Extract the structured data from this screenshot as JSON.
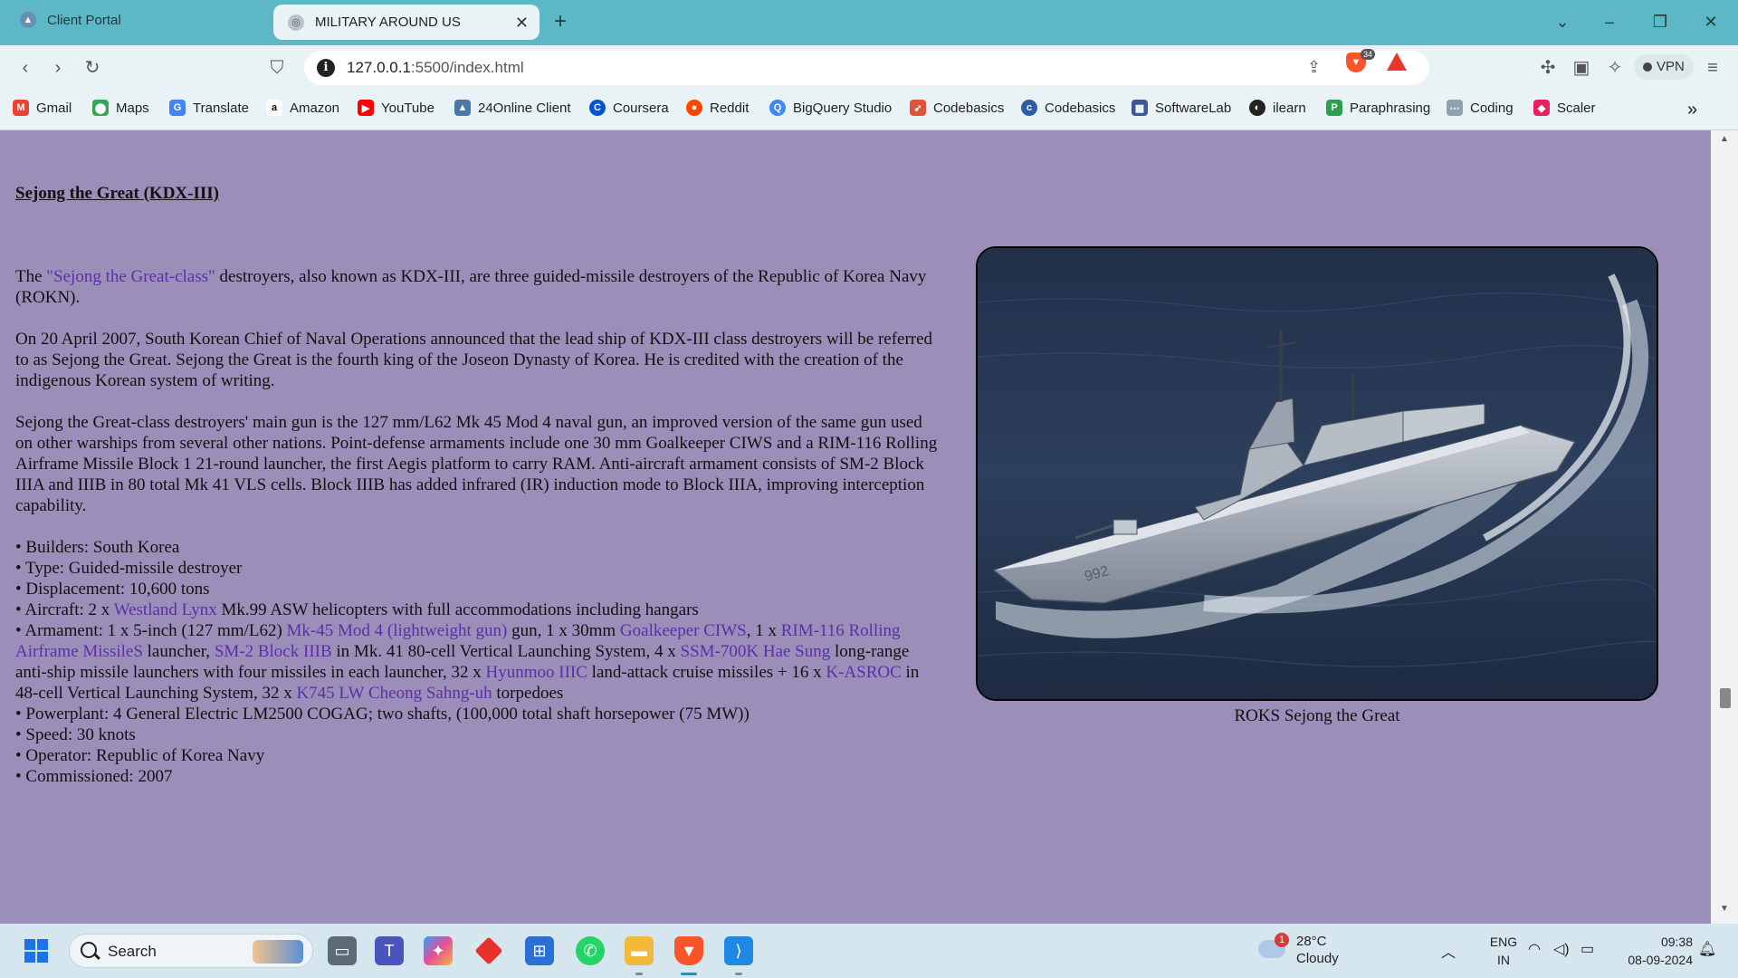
{
  "browser": {
    "tabs": [
      {
        "label": "Client Portal",
        "active": false
      },
      {
        "label": "MILITARY AROUND US",
        "active": true
      }
    ],
    "address": {
      "host": "127.0.0.1",
      "rest": ":5500/index.html"
    },
    "vpn_label": "VPN",
    "shields_count": "34"
  },
  "bookmarks": [
    {
      "label": "Gmail",
      "icon": "gmail-icon",
      "color": "#ea4335"
    },
    {
      "label": "Maps",
      "icon": "maps-icon",
      "color": "#34a853"
    },
    {
      "label": "Translate",
      "icon": "translate-icon",
      "color": "#4285f4"
    },
    {
      "label": "Amazon",
      "icon": "amazon-icon",
      "color": "#111111"
    },
    {
      "label": "YouTube",
      "icon": "youtube-icon",
      "color": "#ff0000"
    },
    {
      "label": "24Online Client",
      "icon": "client-icon",
      "color": "#4a78a8"
    },
    {
      "label": "Coursera",
      "icon": "coursera-icon",
      "color": "#0056d2"
    },
    {
      "label": "Reddit",
      "icon": "reddit-icon",
      "color": "#ff4500"
    },
    {
      "label": "BigQuery Studio",
      "icon": "bigquery-icon",
      "color": "#4285f4"
    },
    {
      "label": "Codebasics",
      "icon": "rocket-icon",
      "color": "#e0533a"
    },
    {
      "label": "Codebasics",
      "icon": "codebasics-icon",
      "color": "#2b5ea7"
    },
    {
      "label": "SoftwareLab",
      "icon": "softwarelab-icon",
      "color": "#3b5998"
    },
    {
      "label": "ilearn",
      "icon": "ilearn-icon",
      "color": "#222222"
    },
    {
      "label": "Paraphrasing",
      "icon": "paraphrasing-icon",
      "color": "#2e9e4f"
    },
    {
      "label": "Coding",
      "icon": "coding-icon",
      "color": "#8fa0b0"
    },
    {
      "label": "Scaler",
      "icon": "scaler-icon",
      "color": "#e8205b"
    }
  ],
  "page": {
    "title": "Sejong the Great (KDX-III)",
    "intro": {
      "pre": "The ",
      "link": "\"Sejong the Great-class\"",
      "post": " destroyers, also known as KDX-III, are three guided-missile destroyers of the Republic of Korea Navy (ROKN)."
    },
    "para2": "On 20 April 2007, South Korean Chief of Naval Operations announced that the lead ship of KDX-III class destroyers will be referred to as Sejong the Great. Sejong the Great is the fourth king of the Joseon Dynasty of Korea. He is credited with the creation of the indigenous Korean system of writing.",
    "para3": "Sejong the Great-class destroyers' main gun is the 127 mm/L62 Mk 45 Mod 4 naval gun, an improved version of the same gun used on other warships from several other nations. Point-defense armaments include one 30 mm Goalkeeper CIWS and a RIM-116 Rolling Airframe Missile Block 1 21-round launcher, the first Aegis platform to carry RAM. Anti-aircraft armament consists of SM-2 Block IIIA and IIIB in 80 total Mk 41 VLS cells. Block IIIB has added infrared (IR) induction mode to Block IIIA, improving interception capability.",
    "bullets": {
      "builders": "• Builders: South Korea",
      "type": "• Type: Guided-missile destroyer",
      "displacement": "• Displacement: 10,600 tons",
      "aircraft_pre": "• Aircraft: 2 x ",
      "aircraft_link": "Westland Lynx",
      "aircraft_post": " Mk.99 ASW helicopters with full accommodations including hangars",
      "arm_1": "• Armament: 1 x 5-inch (127 mm/L62) ",
      "arm_link_1": "Mk-45 Mod 4 (lightweight gun)",
      "arm_2": " gun, 1 x 30mm ",
      "arm_link_2": "Goalkeeper CIWS",
      "arm_3": ", 1 x ",
      "arm_link_3": "RIM-116 Rolling Airframe MissileS",
      "arm_4": " launcher, ",
      "arm_link_4": "SM-2 Block IIIB",
      "arm_5": " in Mk. 41 80-cell Vertical Launching System, 4 x ",
      "arm_link_5": "SSM-700K Hae Sung",
      "arm_6": " long-range anti-ship missile launchers with four missiles in each launcher, 32 x ",
      "arm_link_6": "Hyunmoo IIIC",
      "arm_7": " land-attack cruise missiles + 16 x ",
      "arm_link_7": "K-ASROC",
      "arm_8": " in 48-cell Vertical Launching System, 32 x ",
      "arm_link_8": "K745 LW Cheong Sahng-uh",
      "arm_9": " torpedoes",
      "powerplant": "• Powerplant: 4 General Electric LM2500 COGAG; two shafts, (100,000 total shaft horsepower (75 MW))",
      "speed": "• Speed: 30 knots",
      "operator": "• Operator: Republic of Korea Navy",
      "commissioned": "• Commissioned: 2007"
    },
    "image_caption": "ROKS Sejong the Great"
  },
  "taskbar": {
    "search_label": "Search",
    "weather_temp": "28°C",
    "weather_desc": "Cloudy",
    "weather_badge": "1",
    "lang_1": "ENG",
    "lang_2": "IN",
    "time": "09:38",
    "date": "08-09-2024"
  }
}
